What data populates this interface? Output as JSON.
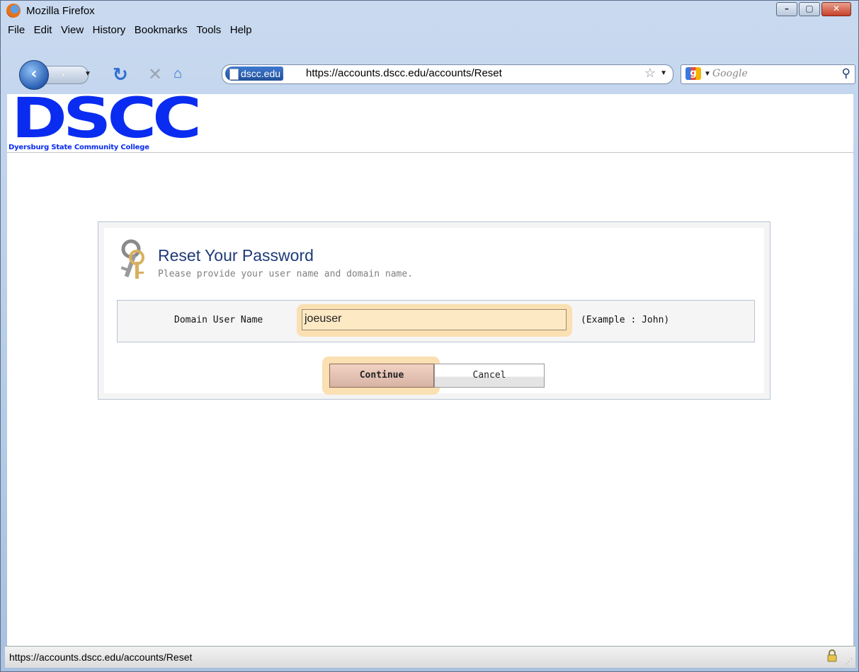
{
  "window": {
    "title": "Mozilla Firefox",
    "buttons": {
      "minimize": "–",
      "maximize": "▢",
      "close": "✕"
    }
  },
  "menu": [
    "File",
    "Edit",
    "View",
    "History",
    "Bookmarks",
    "Tools",
    "Help"
  ],
  "nav": {
    "site_identity": "dscc.edu",
    "url": "https://accounts.dscc.edu/accounts/Reset",
    "search_placeholder": "Google",
    "search_engine_badge": "g"
  },
  "page": {
    "logo": "DSCC",
    "logo_subtitle": "Dyersburg State Community College",
    "form": {
      "title": "Reset Your Password",
      "subtitle": "Please provide your user name and domain name.",
      "field_label": "Domain User Name",
      "field_value": "joeuser",
      "example": "(Example : John)",
      "continue_label": "Continue",
      "cancel_label": "Cancel"
    }
  },
  "status": {
    "text": "https://accounts.dscc.edu/accounts/Reset"
  },
  "icons": [
    "firefox-icon",
    "back-icon",
    "forward-icon",
    "reload-icon",
    "stop-icon",
    "home-icon",
    "page-icon",
    "bookmark-star-icon",
    "search-icon",
    "key-icon",
    "lock-icon"
  ]
}
